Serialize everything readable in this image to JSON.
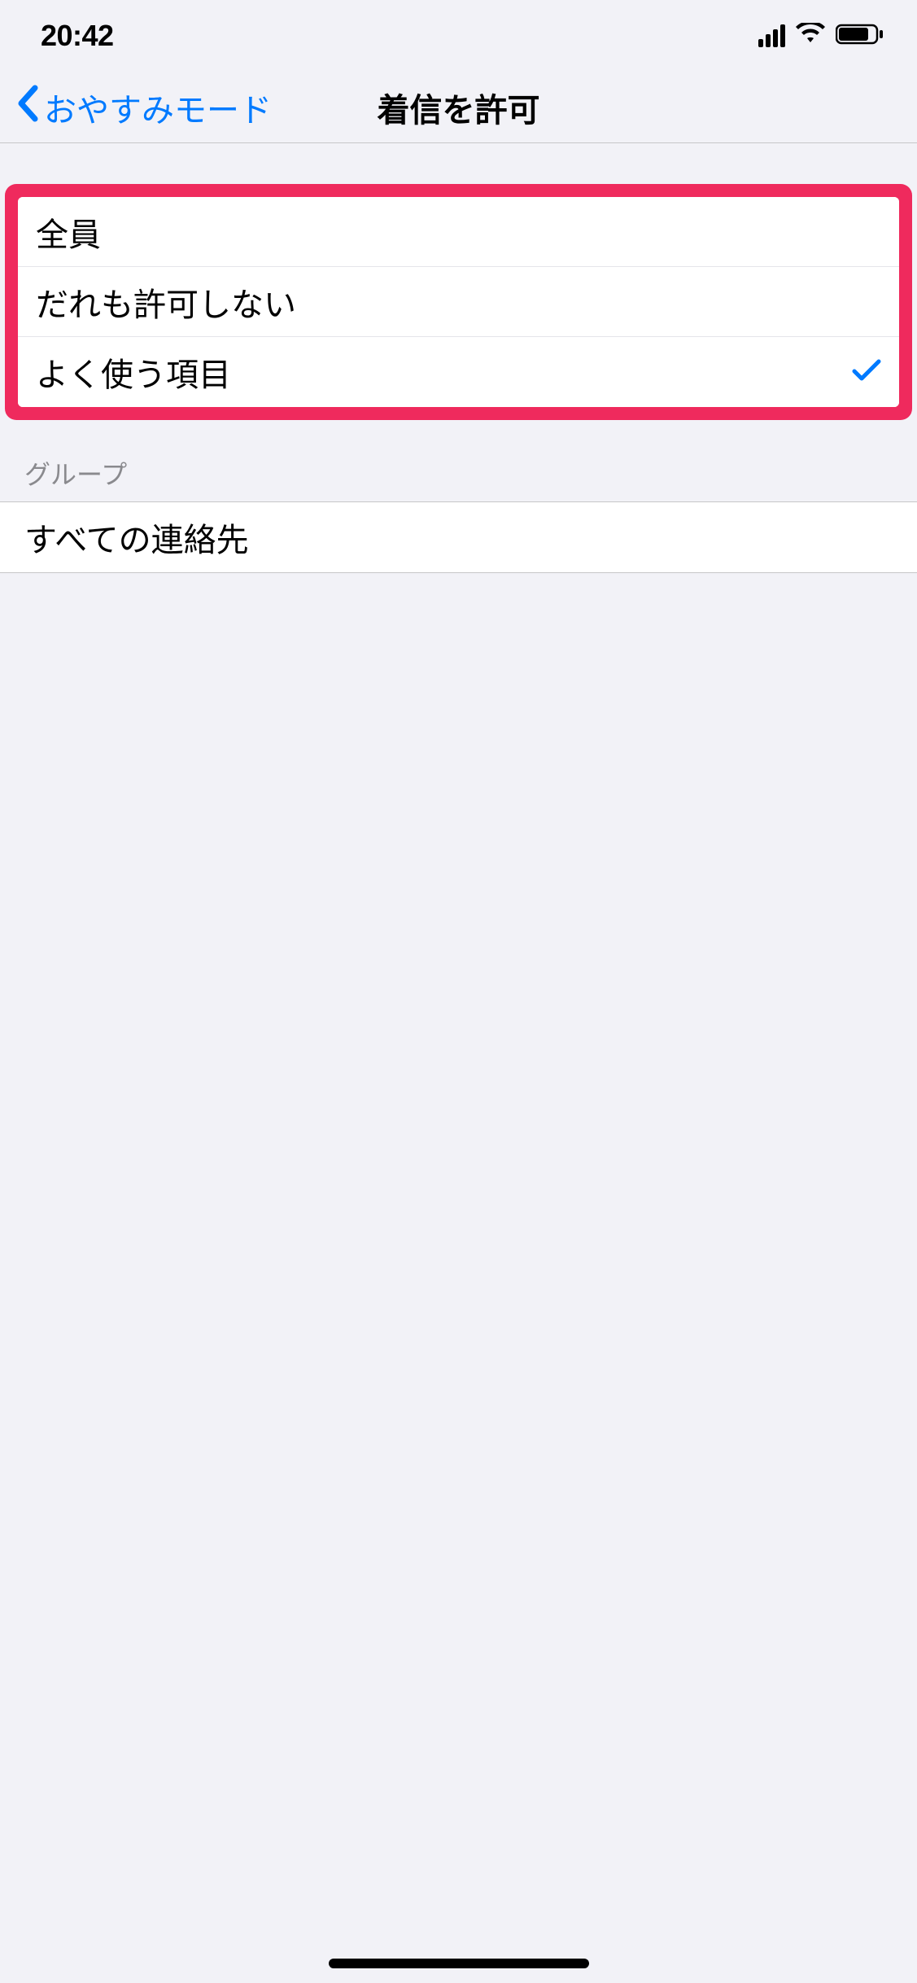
{
  "statusBar": {
    "time": "20:42"
  },
  "navBar": {
    "backLabel": "おやすみモード",
    "title": "着信を許可"
  },
  "options": [
    {
      "label": "全員",
      "selected": false
    },
    {
      "label": "だれも許可しない",
      "selected": false
    },
    {
      "label": "よく使う項目",
      "selected": true
    }
  ],
  "groupSection": {
    "header": "グループ",
    "items": [
      {
        "label": "すべての連絡先",
        "selected": false
      }
    ]
  }
}
